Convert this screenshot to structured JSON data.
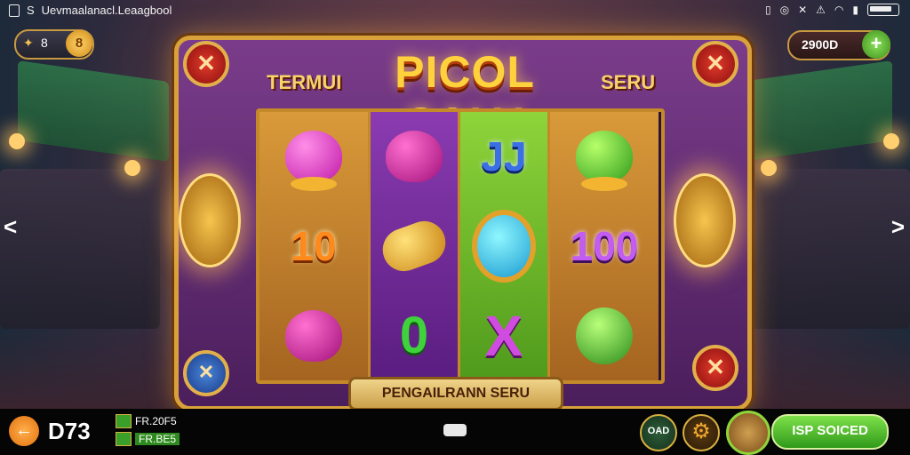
{
  "status_bar": {
    "left_letter": "S",
    "app_name": "Uevmaalanacl.Leaagbool",
    "right_icons": [
      "notification-icon",
      "dnd-icon",
      "close-icon",
      "alert-icon",
      "wifi-icon",
      "signal-icon",
      "battery-icon"
    ]
  },
  "top_left_pill": {
    "icon1": "✦",
    "icon2": "8",
    "coin_label": "8"
  },
  "top_right_pill": {
    "balance": "2900D",
    "plus_label": "+"
  },
  "header": {
    "prefix": "TERMUI",
    "logo": "PICOL SALY",
    "suffix": "SERU"
  },
  "corner_buttons": {
    "close": "✕",
    "special": "✕"
  },
  "reels": [
    {
      "cells": [
        {
          "kind": "fruit",
          "variant": "pink"
        },
        {
          "kind": "text",
          "value": "10",
          "style": "sym-10"
        },
        {
          "kind": "fruit",
          "variant": "magenta"
        }
      ]
    },
    {
      "cells": [
        {
          "kind": "fruit",
          "variant": "magenta"
        },
        {
          "kind": "bell"
        },
        {
          "kind": "text",
          "value": "0",
          "style": "sym-green0"
        }
      ]
    },
    {
      "cells": [
        {
          "kind": "text",
          "value": "JJ",
          "style": "sym-jj"
        },
        {
          "kind": "gem"
        },
        {
          "kind": "text",
          "value": "X",
          "style": "sym-x"
        }
      ]
    },
    {
      "cells": [
        {
          "kind": "fruit",
          "variant": "green"
        },
        {
          "kind": "text",
          "value": "100",
          "style": "sym-100"
        },
        {
          "kind": "melon"
        }
      ]
    }
  ],
  "banner": "PENGAILRANN SERU",
  "nav": {
    "left": "<",
    "right": ">"
  },
  "bottom_bar": {
    "back_label": "←",
    "level": "D73",
    "stat_a": "FR.20F5",
    "stat_b": "FR.BE5",
    "btn_round_label": "OAD",
    "gear": "⚙",
    "start_label": "ISP SOICED"
  },
  "colors": {
    "accent_gold": "#d8a13a",
    "frame_purple": "#7a3c8a",
    "start_green": "#2f9a1a"
  }
}
